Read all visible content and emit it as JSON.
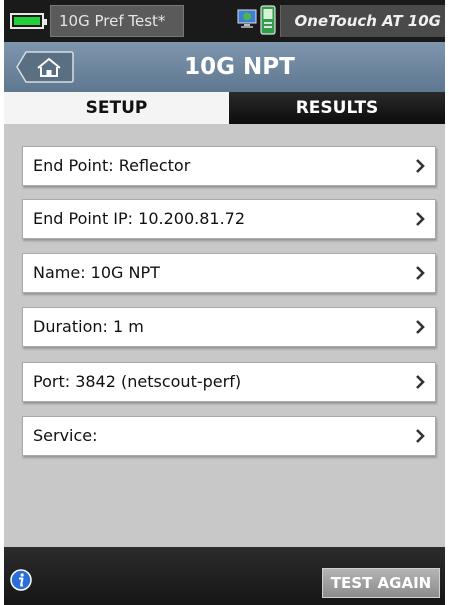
{
  "status_bar": {
    "file_name": "10G Pref Test*",
    "product_name": "OneTouch AT 10G",
    "battery_icon": "battery-full-icon",
    "network_icon": "network-monitor-icon",
    "device_icon": "handheld-device-icon"
  },
  "header": {
    "title": "10G NPT",
    "home_icon": "home-icon"
  },
  "tabs": [
    {
      "label": "SETUP",
      "active": true
    },
    {
      "label": "RESULTS",
      "active": false
    }
  ],
  "settings": [
    {
      "label": "End Point: Reflector"
    },
    {
      "label": "End Point IP: 10.200.81.72"
    },
    {
      "label": "Name: 10G NPT"
    },
    {
      "label": "Duration: 1 m"
    },
    {
      "label": "Port: 3842 (netscout-perf)"
    },
    {
      "label": "Service:"
    }
  ],
  "footer": {
    "info_icon": "info-icon",
    "action_label": "TEST AGAIN"
  },
  "colors": {
    "title_bar": "#6b849c",
    "battery": "#22d13a",
    "info_blue": "#2a6fd6",
    "list_background": "#c8c8c8"
  }
}
